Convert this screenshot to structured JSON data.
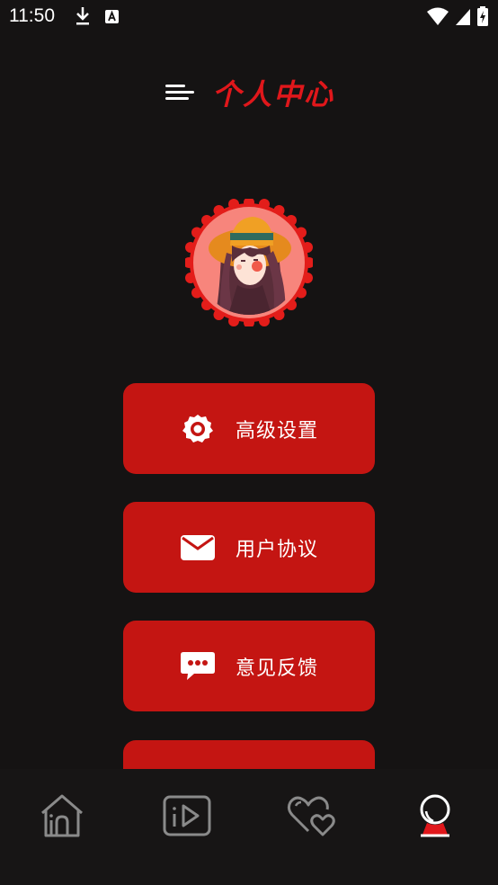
{
  "status_bar": {
    "time": "11:50"
  },
  "header": {
    "title": "个人中心"
  },
  "menu": {
    "items": [
      {
        "label": "高级设置",
        "icon": "gear-icon"
      },
      {
        "label": "用户协议",
        "icon": "envelope-icon"
      },
      {
        "label": "意见反馈",
        "icon": "chat-bubble-icon"
      }
    ]
  },
  "bottom_nav": {
    "items": [
      {
        "icon": "home-icon",
        "active": false
      },
      {
        "icon": "video-icon",
        "active": false
      },
      {
        "icon": "hearts-icon",
        "active": false
      },
      {
        "icon": "profile-icon",
        "active": true
      }
    ]
  },
  "colors": {
    "background": "#151313",
    "accent": "#c41512",
    "title": "#e0171b",
    "inactive_icon": "#8a8a8a"
  }
}
